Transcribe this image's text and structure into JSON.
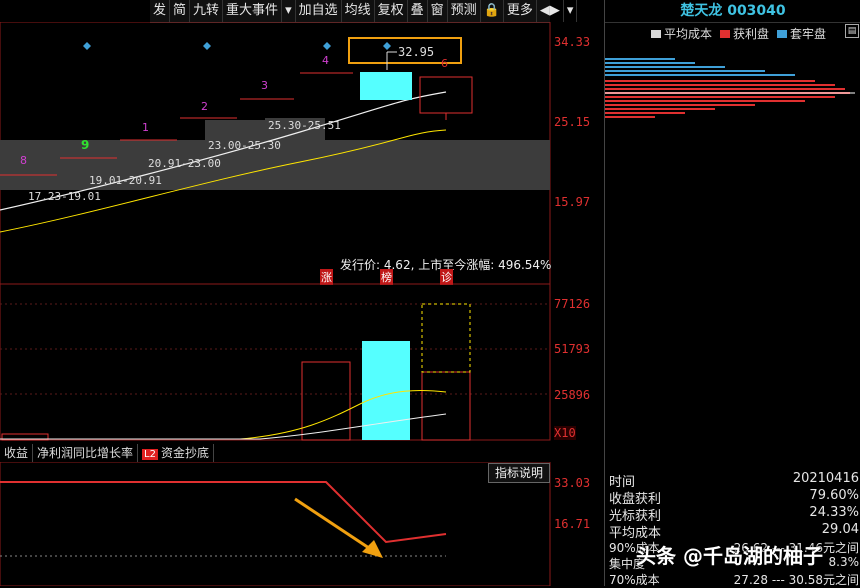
{
  "toolbar": {
    "items": [
      "发",
      "简",
      "九转",
      "重大事件",
      "▾",
      "加自选",
      "均线",
      "复权",
      "叠",
      "窗",
      "预测",
      "🔒",
      "更多",
      "◀▶",
      "▾"
    ]
  },
  "price_axis": {
    "labels": [
      "34.33",
      "25.15",
      "15.97"
    ]
  },
  "price_annotations": {
    "bands": [
      "17.23-19.01",
      "19.01-20.91",
      "20.91-23.00",
      "23.00-25.30",
      "25.30-25.51"
    ],
    "current": "32.95",
    "counts": [
      "8",
      "9",
      "1",
      "2",
      "3",
      "4",
      "6"
    ],
    "ipo_info": "发行价: 4.62, 上市至今涨幅: 496.54%",
    "markers": [
      "涨",
      "榜",
      "诊"
    ]
  },
  "volume_axis": {
    "labels": [
      "77126",
      "51793",
      "25896",
      "X10"
    ]
  },
  "tabs": {
    "items": [
      "收益",
      "净利润同比增长率",
      "资金抄底"
    ],
    "l2": "L2"
  },
  "indicator": {
    "button": "指标说明",
    "labels": [
      "33.03",
      "16.71"
    ]
  },
  "right_panel": {
    "title": "楚天龙  003040",
    "legend": [
      {
        "label": "平均成本",
        "color": "#d8d8d8"
      },
      {
        "label": "获利盘",
        "color": "#e03030"
      },
      {
        "label": "套牢盘",
        "color": "#3fa0d8"
      }
    ],
    "stats": [
      {
        "k": "时间",
        "v": "20210416"
      },
      {
        "k": "收盘获利",
        "v": "79.60%"
      },
      {
        "k": "光标获利",
        "v": "24.33%"
      },
      {
        "k": "平均成本",
        "v": "29.04"
      },
      {
        "k": "90%成本",
        "v": "26.62 --- 31.46元之间"
      },
      {
        "k": "集中度",
        "v": "8.3%"
      },
      {
        "k": "70%成本",
        "v": "27.28 --- 30.58元之间"
      }
    ]
  },
  "watermark": "头条 @千岛湖的柚子",
  "colors": {
    "accent": "#3fc3e3",
    "up": "#e03030",
    "cyan": "#5ff",
    "yellow": "#ffe600"
  }
}
